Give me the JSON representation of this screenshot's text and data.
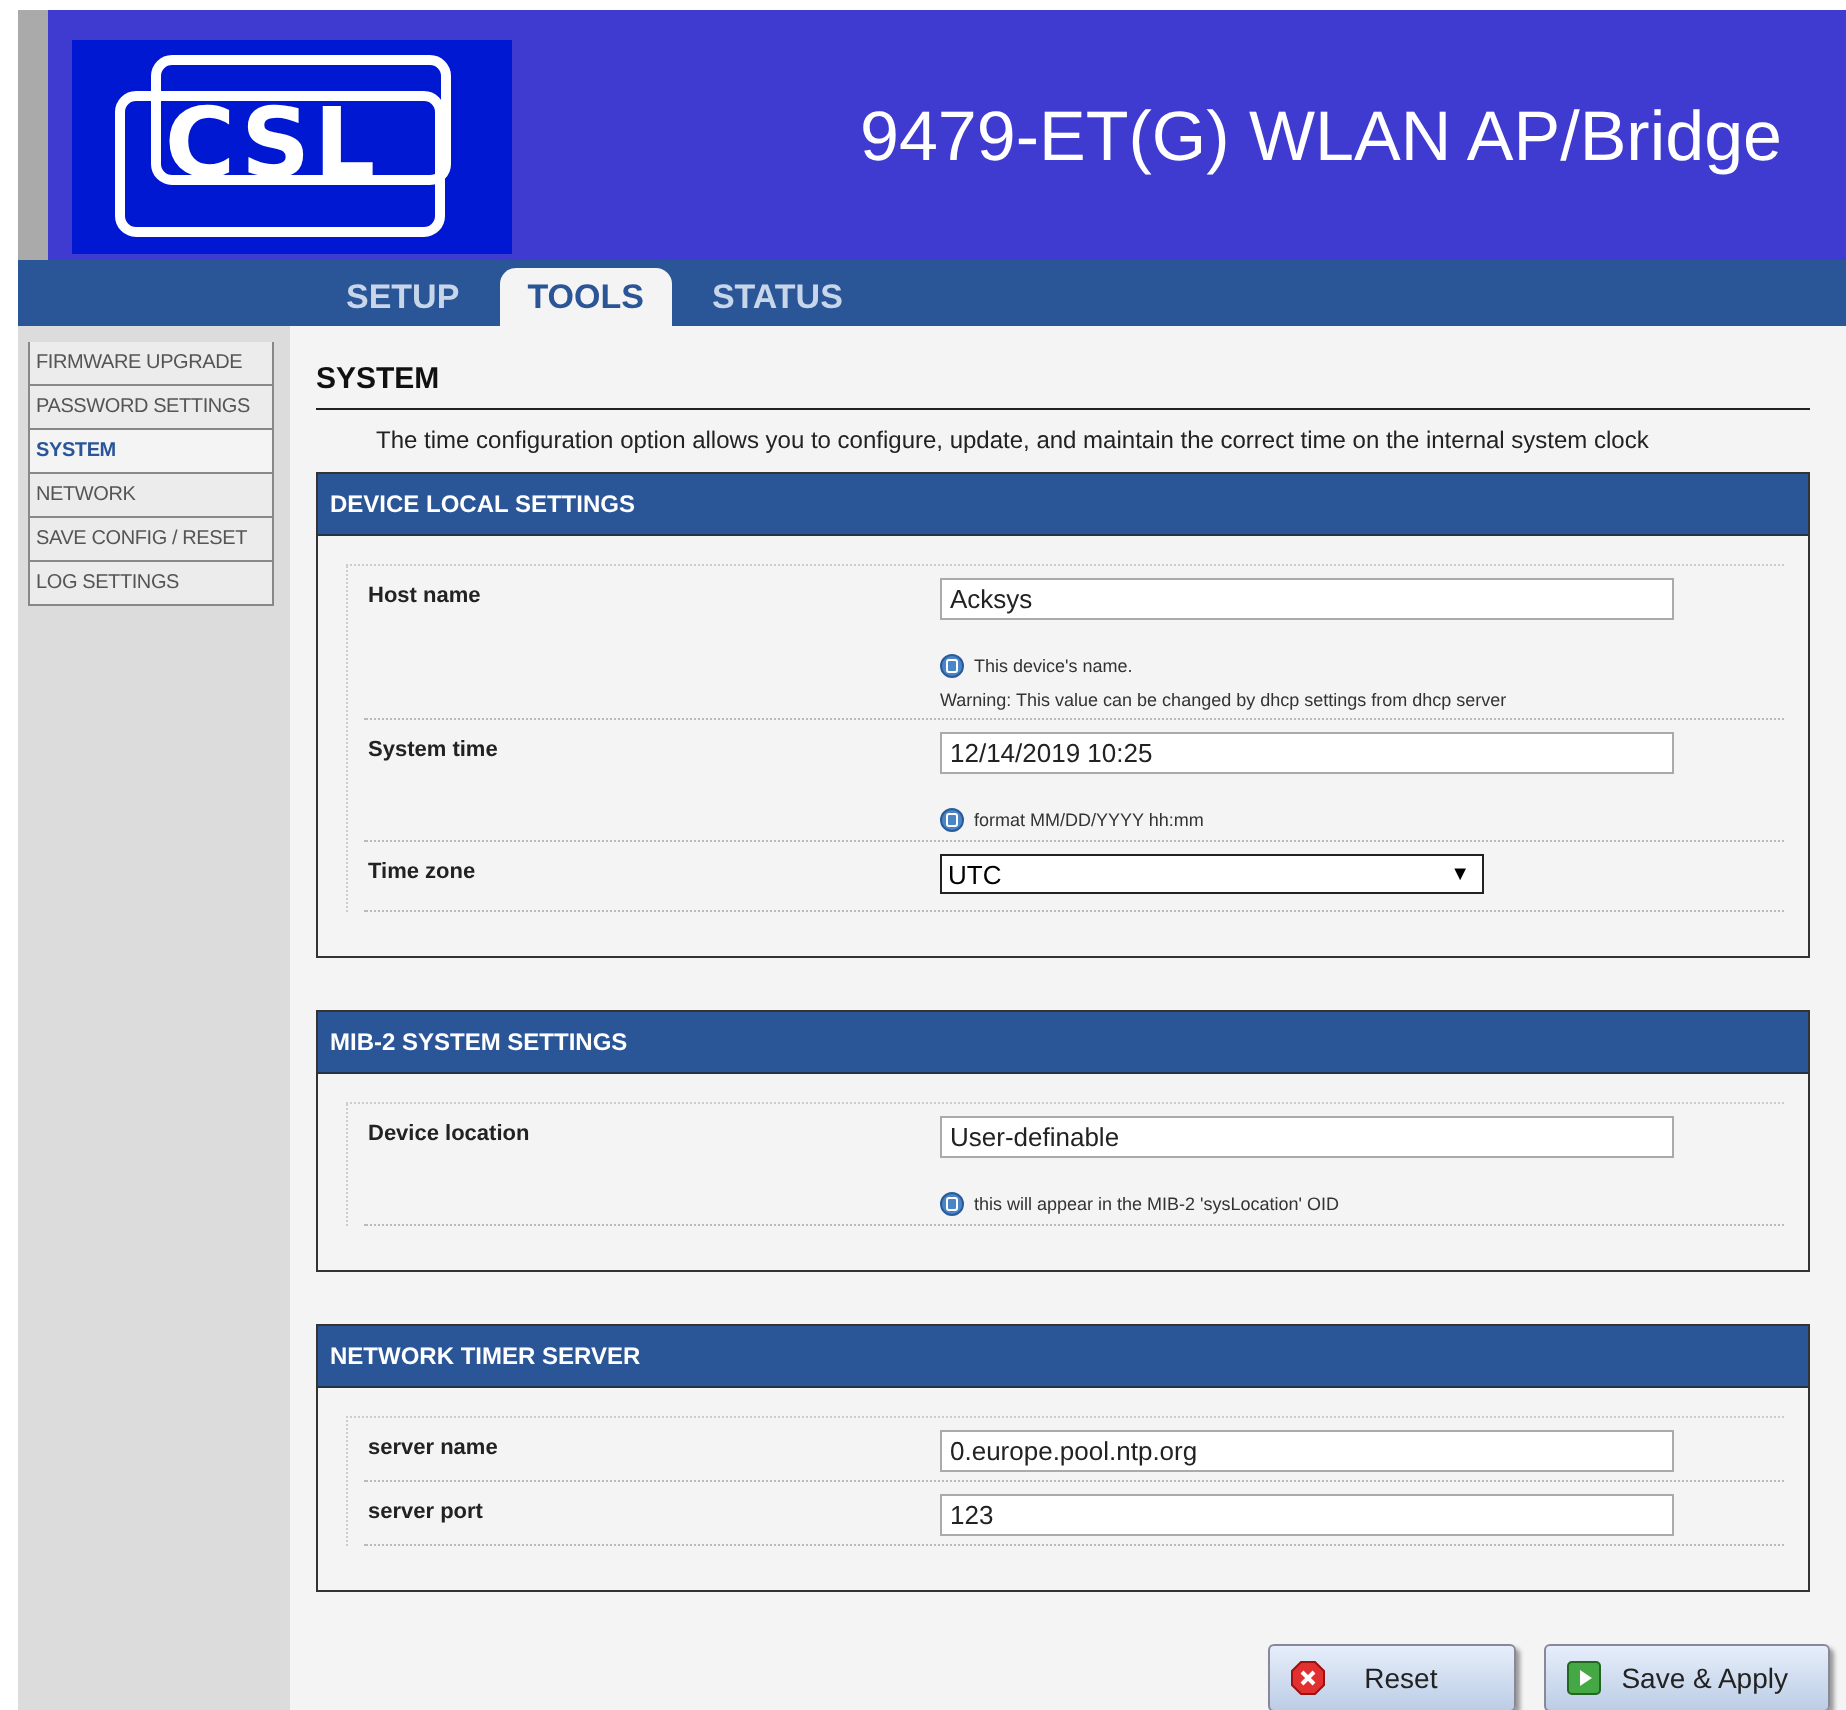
{
  "header": {
    "logo": "CSL",
    "title": "9479-ET(G) WLAN AP/Bridge"
  },
  "tabs": [
    {
      "label": "SETUP",
      "selected": false
    },
    {
      "label": "TOOLS",
      "selected": true
    },
    {
      "label": "STATUS",
      "selected": false
    }
  ],
  "sidebar": {
    "items": [
      {
        "label": "FIRMWARE UPGRADE",
        "selected": false
      },
      {
        "label": "PASSWORD SETTINGS",
        "selected": false
      },
      {
        "label": "SYSTEM",
        "selected": true
      },
      {
        "label": "NETWORK",
        "selected": false
      },
      {
        "label": "SAVE CONFIG / RESET",
        "selected": false
      },
      {
        "label": "LOG SETTINGS",
        "selected": false
      }
    ]
  },
  "page": {
    "title": "SYSTEM",
    "description": "The time configuration option allows you to configure, update, and maintain the correct time on the internal system clock"
  },
  "sections": [
    {
      "title": "DEVICE LOCAL SETTINGS",
      "rows": [
        {
          "label": "Host name",
          "kind": "text",
          "value": "Acksys",
          "help": "This device's name.",
          "note": "Warning: This value can be changed by dhcp settings from dhcp server"
        },
        {
          "label": "System time",
          "kind": "text",
          "value": "12/14/2019 10:25",
          "help": "format MM/DD/YYYY hh:mm"
        },
        {
          "label": "Time zone",
          "kind": "select",
          "value": "UTC",
          "arrow": "▼"
        }
      ]
    },
    {
      "title": "MIB-2 SYSTEM SETTINGS",
      "rows": [
        {
          "label": "Device location",
          "kind": "text",
          "value": "User-definable",
          "help": "this will appear in the MIB-2 'sysLocation' OID"
        }
      ]
    },
    {
      "title": "NETWORK TIMER SERVER",
      "rows": [
        {
          "label": "server name",
          "kind": "text",
          "value": "0.europe.pool.ntp.org"
        },
        {
          "label": "server port",
          "kind": "text",
          "value": "123"
        }
      ]
    }
  ],
  "buttons": [
    {
      "label": "Reset",
      "kind": "reset"
    },
    {
      "label": "Save & Apply",
      "kind": "apply"
    }
  ]
}
